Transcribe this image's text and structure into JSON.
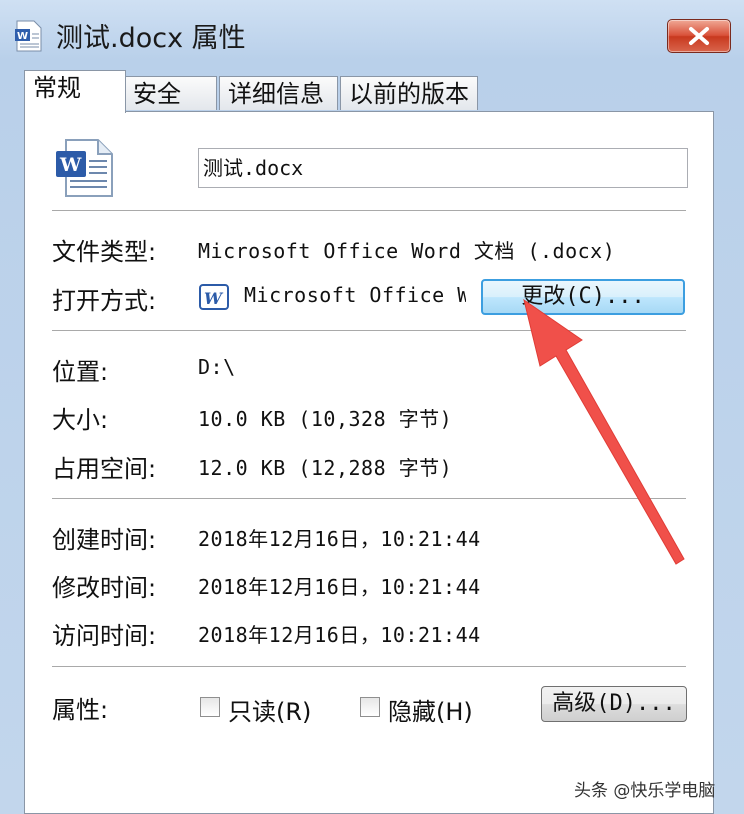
{
  "window": {
    "title": "测试.docx 属性",
    "close_icon": "close-icon"
  },
  "tabs": [
    {
      "label": "常规",
      "active": true
    },
    {
      "label": "安全",
      "active": false
    },
    {
      "label": "详细信息",
      "active": false
    },
    {
      "label": "以前的版本",
      "active": false
    }
  ],
  "file": {
    "name": "测试.docx",
    "icon": "word-document-icon"
  },
  "type_row": {
    "label": "文件类型:",
    "value": "Microsoft Office Word 文档 (.docx)"
  },
  "open_row": {
    "label": "打开方式:",
    "value": "Microsoft Office Word",
    "icon": "word-app-icon",
    "button": "更改(C)..."
  },
  "location_row": {
    "label": "位置:",
    "value": "D:\\"
  },
  "size_row": {
    "label": "大小:",
    "value": "10.0 KB (10,328 字节)"
  },
  "disk_row": {
    "label": "占用空间:",
    "value": "12.0 KB (12,288 字节)"
  },
  "created_row": {
    "label": "创建时间:",
    "value": "2018年12月16日，10:21:44"
  },
  "modified_row": {
    "label": "修改时间:",
    "value": "2018年12月16日，10:21:44"
  },
  "accessed_row": {
    "label": "访问时间:",
    "value": "2018年12月16日，10:21:44"
  },
  "attributes": {
    "label": "属性:",
    "readonly": {
      "label": "只读(R)",
      "checked": false
    },
    "hidden": {
      "label": "隐藏(H)",
      "checked": false
    },
    "advanced_button": "高级(D)..."
  },
  "annotation": {
    "color": "#f0504a"
  },
  "watermark": "头条 @快乐学电脑"
}
